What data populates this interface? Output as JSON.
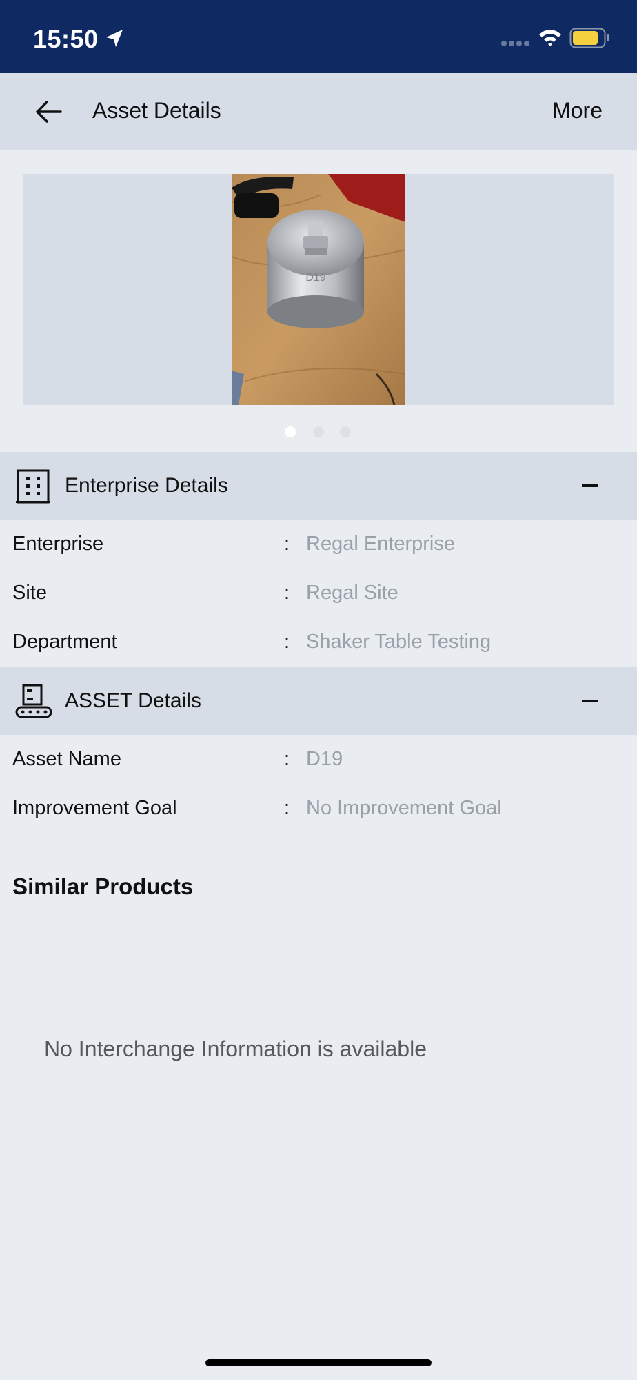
{
  "status_bar": {
    "time": "15:50"
  },
  "header": {
    "title": "Asset Details",
    "more_label": "More"
  },
  "carousel": {
    "photo_engraving": "D19",
    "page_count": 3,
    "active_index": 0
  },
  "enterprise_section": {
    "title": "Enterprise Details",
    "rows": [
      {
        "label": "Enterprise",
        "value": "Regal Enterprise"
      },
      {
        "label": "Site",
        "value": "Regal Site"
      },
      {
        "label": "Department",
        "value": "Shaker Table Testing"
      }
    ]
  },
  "asset_section": {
    "title": "ASSET Details",
    "rows": [
      {
        "label": "Asset Name",
        "value": "D19"
      },
      {
        "label": "Improvement Goal",
        "value": "No Improvement Goal"
      }
    ]
  },
  "separator": ":",
  "similar_products": {
    "title": "Similar Products",
    "empty_message": "No Interchange Information is available"
  },
  "colors": {
    "status_bar": "#0f2a63",
    "header_bg": "#d7dde7",
    "page_bg": "#e9ecf1",
    "value_text": "#9aa0a8"
  }
}
